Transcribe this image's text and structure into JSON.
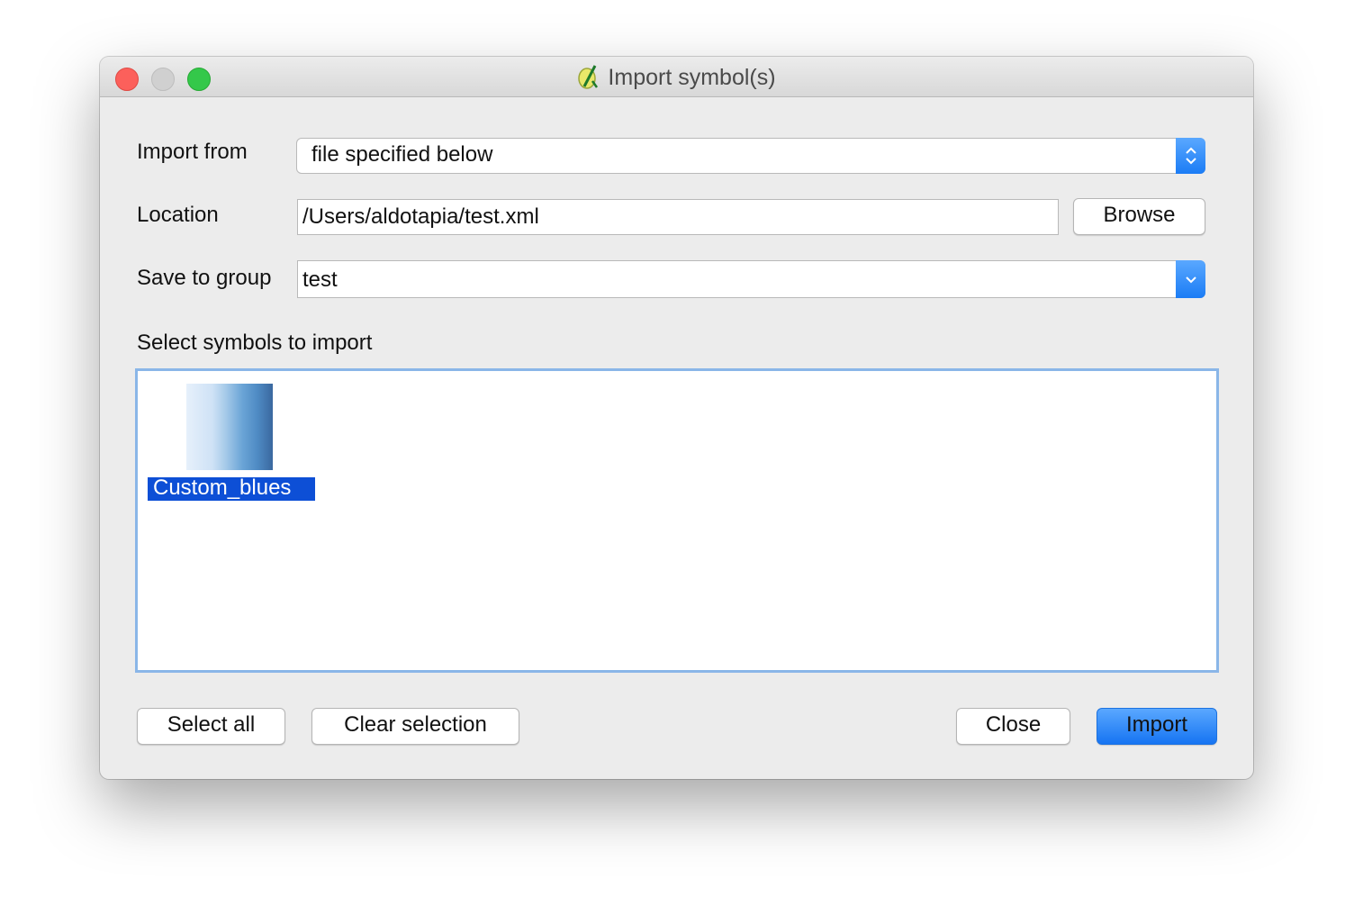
{
  "window": {
    "title": "Import symbol(s)",
    "title_icon": "qgis-icon",
    "controls": [
      "close",
      "minimize",
      "maximize"
    ]
  },
  "form": {
    "import_from": {
      "label": "Import from",
      "value": "file specified below",
      "control": "combo-updown"
    },
    "location": {
      "label": "Location",
      "value": "/Users/aldotapia/test.xml",
      "browse_label": "Browse"
    },
    "save_to_group": {
      "label": "Save to group",
      "value": "test",
      "control": "combo-down"
    },
    "symbols_label": "Select symbols to import"
  },
  "symbols": [
    {
      "name": "Custom_blues",
      "selected": true,
      "type": "color-ramp"
    }
  ],
  "buttons": {
    "select_all": "Select all",
    "clear_selection": "Clear selection",
    "close": "Close",
    "import": "Import"
  },
  "colors": {
    "accent": "#1b7cf5",
    "selection": "#0d4fd6",
    "listbox_focus": "#8ab6e8"
  }
}
